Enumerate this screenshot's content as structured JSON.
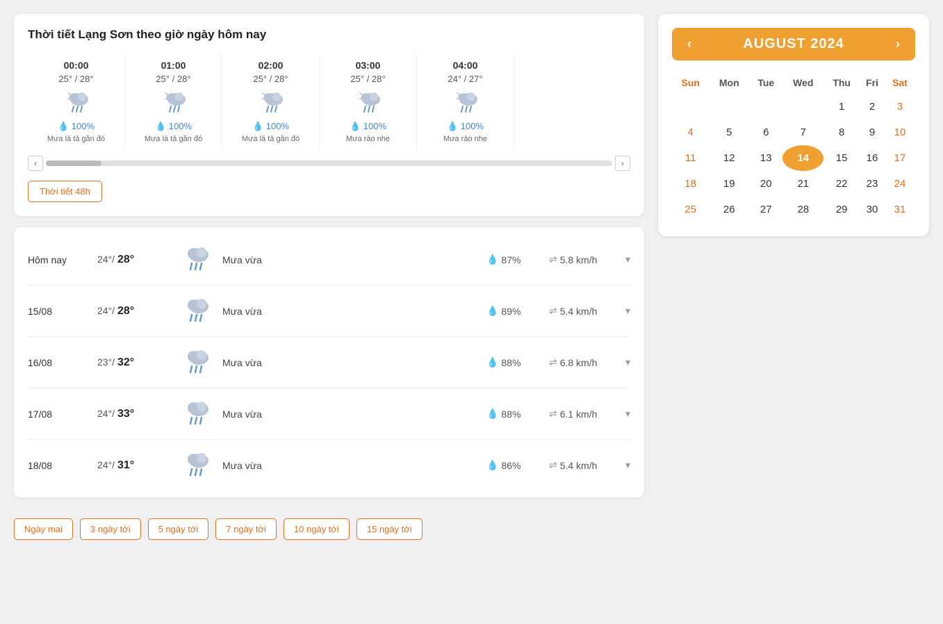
{
  "page": {
    "title": "Thời tiết Lạng Sơn theo giờ ngày hôm nay"
  },
  "hourly": {
    "items": [
      {
        "time": "00:00",
        "temp": "25° / 28°",
        "rain": "100%",
        "desc": "Mưa lá tả gần đó"
      },
      {
        "time": "01:00",
        "temp": "25° / 28°",
        "rain": "100%",
        "desc": "Mưa lá tả gần đó"
      },
      {
        "time": "02:00",
        "temp": "25° / 28°",
        "rain": "100%",
        "desc": "Mưa lá tả gần đó"
      },
      {
        "time": "03:00",
        "temp": "25° / 28°",
        "rain": "100%",
        "desc": "Mưa rào nhẹ"
      },
      {
        "time": "04:00",
        "temp": "24° / 27°",
        "rain": "100%",
        "desc": "Mưa rào nhẹ"
      }
    ],
    "btn_48h": "Thời tiết 48h"
  },
  "forecast": {
    "rows": [
      {
        "date": "Hôm nay",
        "temp_low": "24°",
        "temp_high": "28°",
        "desc": "Mưa vừa",
        "rain": "87%",
        "wind": "5.8 km/h"
      },
      {
        "date": "15/08",
        "temp_low": "24°",
        "temp_high": "28°",
        "desc": "Mưa vừa",
        "rain": "89%",
        "wind": "5.4 km/h"
      },
      {
        "date": "16/08",
        "temp_low": "23°",
        "temp_high": "32°",
        "desc": "Mưa vừa",
        "rain": "88%",
        "wind": "6.8 km/h"
      },
      {
        "date": "17/08",
        "temp_low": "24°",
        "temp_high": "33°",
        "desc": "Mưa vừa",
        "rain": "88%",
        "wind": "6.1 km/h"
      },
      {
        "date": "18/08",
        "temp_low": "24°",
        "temp_high": "31°",
        "desc": "Mưa vừa",
        "rain": "86%",
        "wind": "5.4 km/h"
      }
    ]
  },
  "day_buttons": [
    "Ngày mai",
    "3 ngày tới",
    "5 ngày tới",
    "7 ngày tới",
    "10 ngày tới",
    "15 ngày tới"
  ],
  "calendar": {
    "month_label": "AUGUST 2024",
    "days_header": [
      "Sun",
      "Mon",
      "Tue",
      "Wed",
      "Thu",
      "Fri",
      "Sat"
    ],
    "weeks": [
      [
        "",
        "",
        "",
        "",
        "1",
        "2",
        "3"
      ],
      [
        "4",
        "5",
        "6",
        "7",
        "8",
        "9",
        "10"
      ],
      [
        "11",
        "12",
        "13",
        "14",
        "15",
        "16",
        "17"
      ],
      [
        "18",
        "19",
        "20",
        "21",
        "22",
        "23",
        "24"
      ],
      [
        "25",
        "26",
        "27",
        "28",
        "29",
        "30",
        "31"
      ]
    ],
    "today_date": "14"
  }
}
